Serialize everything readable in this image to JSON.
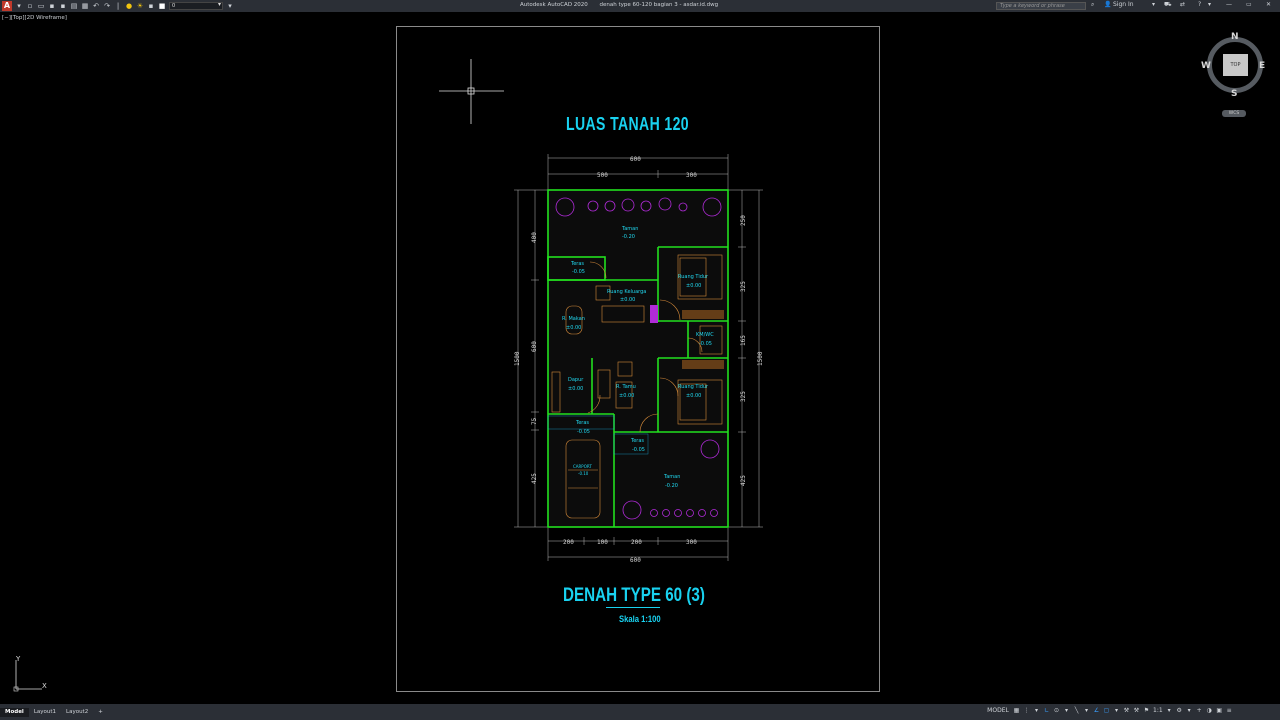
{
  "titlebar": {
    "app_logo": "A",
    "layer_value": "0",
    "app_name": "Autodesk AutoCAD 2020",
    "file_name": "denah type 60-120 bagian 3 - asdar.id.dwg",
    "search_placeholder": "Type a keyword or phrase",
    "sign_in": "Sign In"
  },
  "viewport": {
    "label": "[−][Top][2D Wireframe]"
  },
  "drawing": {
    "title_top": "LUAS TANAH 120",
    "title_bottom": "DENAH TYPE 60 (3)",
    "scale": "Skala 1:100",
    "dimensions": {
      "top_total": "600",
      "top_left": "500",
      "top_right": "300",
      "bottom_total": "600",
      "bottom_1": "200",
      "bottom_2": "100",
      "bottom_3": "200",
      "bottom_4": "300",
      "left_1": "400",
      "left_2": "600",
      "left_3": "75",
      "left_4": "425",
      "left_total": "1500",
      "right_1": "250",
      "right_2": "325",
      "right_3": "165",
      "right_4": "325",
      "right_5": "425",
      "right_total": "1500"
    },
    "rooms": [
      {
        "name": "Taman",
        "level": "-0.20"
      },
      {
        "name": "Teras",
        "level": "-0.05"
      },
      {
        "name": "Ruang Keluarga",
        "level": "±0.00"
      },
      {
        "name": "Ruang Tidur",
        "level": "±0.00"
      },
      {
        "name": "R. Makan",
        "level": "±0.00"
      },
      {
        "name": "KM/WC",
        "level": "-0.05"
      },
      {
        "name": "Dapur",
        "level": "±0.00"
      },
      {
        "name": "R. Tamu",
        "level": "±0.00"
      },
      {
        "name": "Ruang Tidur",
        "level": "±0.00"
      },
      {
        "name": "Teras",
        "level": "-0.05"
      },
      {
        "name": "Teras",
        "level": "-0.05"
      },
      {
        "name": "CARPORT",
        "level": "-0.10"
      },
      {
        "name": "Taman",
        "level": "-0.20"
      }
    ]
  },
  "compass": {
    "north": "N",
    "south": "S",
    "east": "E",
    "west": "W",
    "top": "TOP",
    "wcs": "WCS"
  },
  "ucs": {
    "x": "X",
    "y": "Y"
  },
  "statusbar": {
    "tabs": [
      "Model",
      "Layout1",
      "Layout2"
    ],
    "add_tab": "+",
    "model_label": "MODEL",
    "scale": "1:1"
  },
  "colors": {
    "wall": "#22e01e",
    "cyan_text": "#19d2f0",
    "plant": "#b02bd8",
    "furniture": "#d58a3a"
  }
}
